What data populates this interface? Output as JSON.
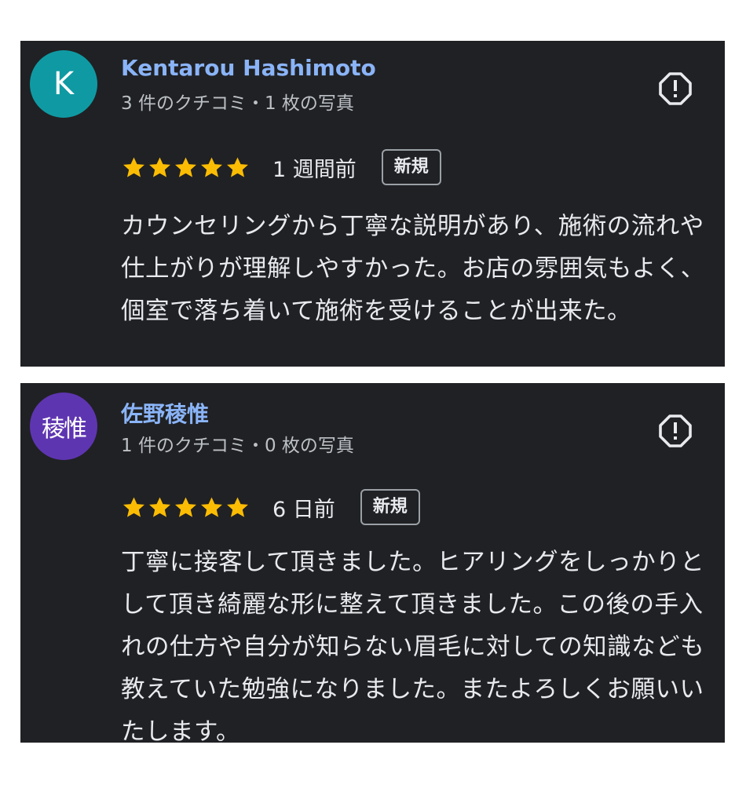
{
  "reviews": [
    {
      "avatar_text": "K",
      "avatar_color": "#0f9aa3",
      "name": "Kentarou Hashimoto",
      "meta": "3 件のクチコミ・1 枚の写真",
      "rating": 5,
      "date": "1 週間前",
      "badge": "新規",
      "text": "カウンセリングから丁寧な説明があり、施術の流れや仕上がりが理解しやすかった。お店の雰囲気もよく、個室で落ち着いて施術を受けることが出来た。",
      "report_icon": "report-icon"
    },
    {
      "avatar_text": "稜惟",
      "avatar_color": "#5e35b1",
      "name": "佐野稜惟",
      "meta": "1 件のクチコミ・0 枚の写真",
      "rating": 5,
      "date": "6 日前",
      "badge": "新規",
      "text": "丁寧に接客して頂きました。ヒアリングをしっかりとして頂き綺麗な形に整えて頂きました。この後の手入れの仕方や自分が知らない眉毛に対しての知識なども教えていた勉強になりました。またよろしくお願いいたします。",
      "report_icon": "report-icon"
    }
  ],
  "colors": {
    "card_background": "#202124",
    "name_link": "#8ab4f8",
    "star": "#fbbc04",
    "text": "#e8eaed",
    "meta_text": "#bdc1c6"
  }
}
